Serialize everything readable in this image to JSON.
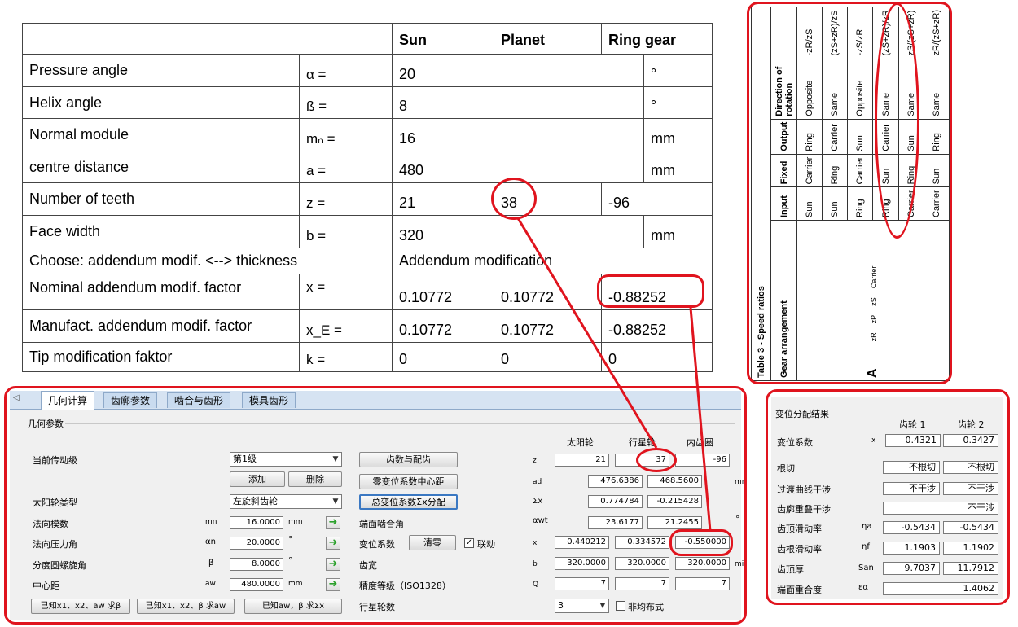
{
  "top_table": {
    "headers": [
      "Sun",
      "Planet",
      "Ring gear"
    ],
    "rows": [
      {
        "label": "Pressure angle",
        "symbol": "α =",
        "v1": "20",
        "unit": "°"
      },
      {
        "label": "Helix angle",
        "symbol": "ß =",
        "v1": "8",
        "unit": "°"
      },
      {
        "label": "Normal module",
        "symbol": "mₙ =",
        "v1": "16",
        "unit": "mm"
      },
      {
        "label": "centre distance",
        "symbol": "a =",
        "v1": "480",
        "unit": "mm"
      },
      {
        "label": "Number of teeth",
        "symbol": "z =",
        "v1": "21",
        "v2": "38",
        "v3": "-96"
      },
      {
        "label": "Face width",
        "symbol": "b =",
        "v1": "320",
        "unit": "mm"
      },
      {
        "label": "Choose: addendum modif. <--> thickness",
        "v1": "Addendum modification"
      },
      {
        "label": "Nominal addendum modif. factor",
        "symbol": "x =",
        "v1": "0.10772",
        "v2": "0.10772",
        "v3": "-0.88252"
      },
      {
        "label": "Manufact. addendum modif. factor",
        "symbol": "x_E =",
        "v1": "0.10772",
        "v2": "0.10772",
        "v3": "-0.88252"
      },
      {
        "label": "Tip modification faktor",
        "symbol": "k =",
        "v1": "0",
        "v2": "0",
        "v3": "0"
      }
    ]
  },
  "speed_table": {
    "title": "Table 3 - Speed ratios",
    "col_headers": [
      "Gear arrangement",
      "Input",
      "Fixed",
      "Output",
      "Direction of rotation",
      ""
    ],
    "inputs": [
      "Sun",
      "Sun",
      "Ring",
      "Ring",
      "Carrier",
      "Carrier"
    ],
    "fixed": [
      "Carrier",
      "Ring",
      "Carrier",
      "Sun",
      "Ring",
      "Sun"
    ],
    "outputs": [
      "Ring",
      "Carrier",
      "Sun",
      "Carrier",
      "Sun",
      "Ring"
    ],
    "directions": [
      "Opposite",
      "Same",
      "Opposite",
      "Same",
      "Same",
      "Same"
    ],
    "ratios": [
      "-zR/zS",
      "(zS+zR)/zS",
      "-zS/zR",
      "(zS+zR)/zR",
      "zS/(zS+zR)",
      "zR/(zS+zR)"
    ],
    "arrangement_label": "A",
    "diagram_labels": {
      "zr": "zR",
      "zp": "zP",
      "zs": "zS",
      "carrier": "Carrier"
    }
  },
  "app": {
    "tabs": [
      "几何计算",
      "齿廓参数",
      "啮合与齿形",
      "模具齿形"
    ],
    "group_title": "几何参数",
    "col_headers": [
      "太阳轮",
      "行星轮",
      "内齿圈"
    ],
    "labels": {
      "stage": "当前传动级",
      "sun_type": "太阳轮类型",
      "mn": "法向模数",
      "alpha_n": "法向压力角",
      "beta": "分度圆螺旋角",
      "center": "中心距",
      "alpha_wt": "端面啮合角",
      "shift": "变位系数",
      "width": "齿宽",
      "accuracy": "精度等级（ISO1328）",
      "planets": "行星轮数"
    },
    "symbols": {
      "mn": "mn",
      "alpha_n": "αn",
      "beta": "β",
      "aw": "aw",
      "z": "z",
      "ad": "ad",
      "sx": "Σx",
      "awt": "αwt",
      "x": "x",
      "b": "b",
      "q": "Q"
    },
    "units": {
      "mm": "mm",
      "deg": "°",
      "mr": "mr",
      "mi": "mi"
    },
    "stage_value": "第1级",
    "sun_type_value": "左旋斜齿轮",
    "mn_value": "16.0000",
    "alpha_n_value": "20.0000",
    "beta_value": "8.0000",
    "aw_value": "480.0000",
    "buttons": {
      "add": "添加",
      "delete": "删除",
      "teeth": "齿数与配齿",
      "zero_center": "零变位系数中心距",
      "total_shift": "总变位系数Σx分配",
      "clear": "清零",
      "calc_beta": "已知x1、x2、aw 求β",
      "calc_aw": "已知x1、x2、β 求aw",
      "calc_sx": "已知aw，β 求Σx"
    },
    "link_label": "联动",
    "nonuniform_label": "非均布式",
    "planets_value": "3",
    "z_values": [
      "21",
      "37",
      "-96"
    ],
    "ad_values": [
      "476.6386",
      "468.5600"
    ],
    "sx_values": [
      "0.774784",
      "-0.215428"
    ],
    "awt_values": [
      "23.6177",
      "21.2455"
    ],
    "x_values": [
      "0.440212",
      "0.334572",
      "-0.550000"
    ],
    "b_values": [
      "320.0000",
      "320.0000",
      "320.0000"
    ],
    "q_values": [
      "7",
      "7",
      "7"
    ]
  },
  "result": {
    "title": "变位分配结果",
    "col_headers": [
      "齿轮 1",
      "齿轮 2"
    ],
    "rows": [
      {
        "label": "变位系数",
        "sym": "x",
        "v1": "0.4321",
        "v2": "0.3427"
      },
      {
        "label": "根切",
        "sym": "",
        "v1": "不根切",
        "v2": "不根切"
      },
      {
        "label": "过渡曲线干涉",
        "sym": "",
        "v1": "不干涉",
        "v2": "不干涉"
      },
      {
        "label": "齿廓重叠干涉",
        "sym": "",
        "v1": "",
        "v2": "不干涉"
      },
      {
        "label": "齿顶滑动率",
        "sym": "ηa",
        "v1": "-0.5434",
        "v2": "-0.5434"
      },
      {
        "label": "齿根滑动率",
        "sym": "ηf",
        "v1": "1.1903",
        "v2": "1.1902"
      },
      {
        "label": "齿顶厚",
        "sym": "San",
        "v1": "9.7037",
        "v2": "11.7912"
      },
      {
        "label": "端面重合度",
        "sym": "εα",
        "v1": "",
        "v2": "1.4062"
      }
    ]
  },
  "colors": {
    "annotation": "#e0141e",
    "tab_bg": "#d6e3f2",
    "arrow": "#2aa02a"
  }
}
